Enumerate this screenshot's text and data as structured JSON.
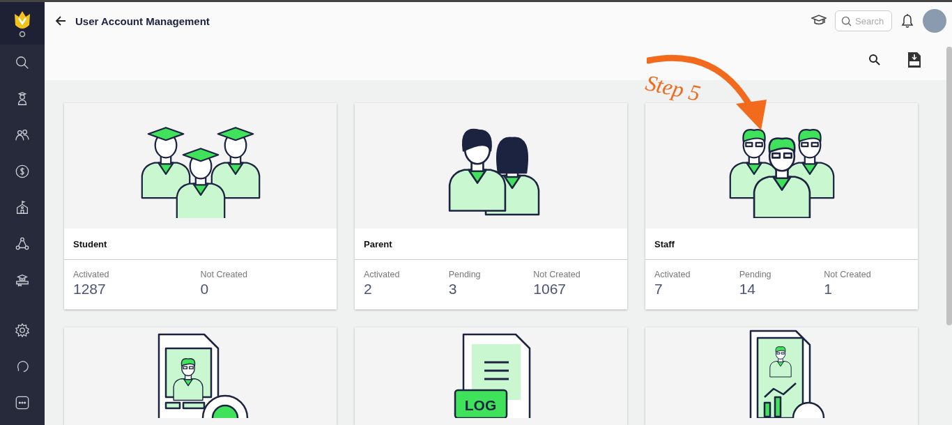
{
  "header": {
    "title": "User Account Management",
    "search_placeholder": "Search"
  },
  "annotation": {
    "text": "Step 5"
  },
  "cards": [
    {
      "kind": "students",
      "title": "Student",
      "stats": [
        {
          "label": "Activated",
          "value": "1287"
        },
        {
          "label": "Not Created",
          "value": "0"
        }
      ]
    },
    {
      "kind": "parents",
      "title": "Parent",
      "stats": [
        {
          "label": "Activated",
          "value": "2"
        },
        {
          "label": "Pending",
          "value": "3"
        },
        {
          "label": "Not Created",
          "value": "1067"
        }
      ]
    },
    {
      "kind": "staff",
      "title": "Staff",
      "stats": [
        {
          "label": "Activated",
          "value": "7"
        },
        {
          "label": "Pending",
          "value": "14"
        },
        {
          "label": "Not Created",
          "value": "1"
        }
      ]
    }
  ],
  "tool_cards": [
    {
      "kind": "profile-settings"
    },
    {
      "kind": "log",
      "badge": "LOG"
    },
    {
      "kind": "report-download"
    }
  ]
}
